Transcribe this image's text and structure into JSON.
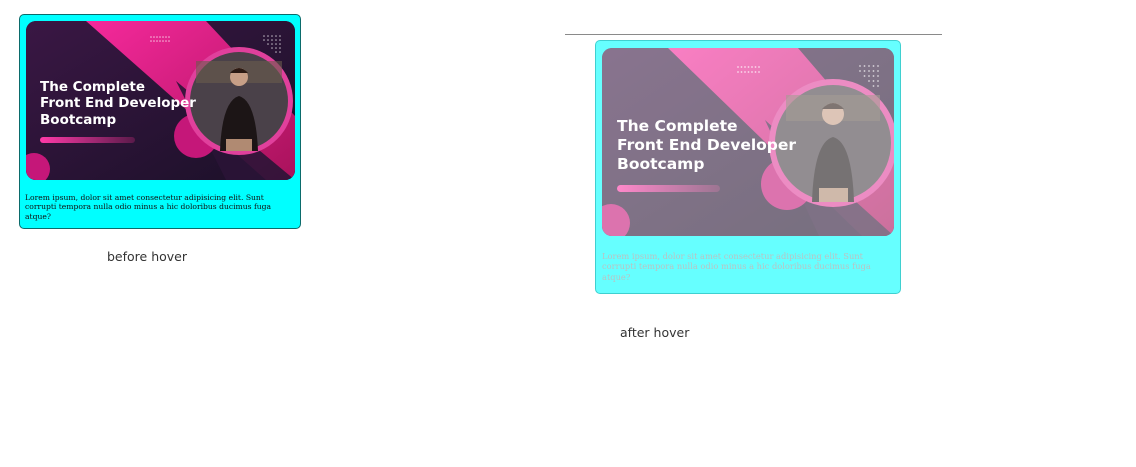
{
  "cards": {
    "before": {
      "banner_title": "The Complete\nFront End Developer\nBootcamp",
      "description": "Lorem ipsum, dolor sit amet consectetur adipisicing elit. Sunt corrupti tempora nulla odio minus a hic doloribus ducimus fuga atque?",
      "caption": "before hover"
    },
    "after": {
      "banner_title": "The Complete\nFront End Developer\nBootcamp",
      "description": "Lorem ipsum, dolor sit amet consectetur adipisicing elit. Sunt corrupti tempora nulla odio minus a hic doloribus ducimus fuga atque?",
      "caption": "after hover"
    }
  },
  "colors": {
    "card_background": "#00ffff",
    "banner_dark": "#1f1330",
    "banner_magenta": "#d4147f",
    "banner_pink": "#e83e9c"
  }
}
